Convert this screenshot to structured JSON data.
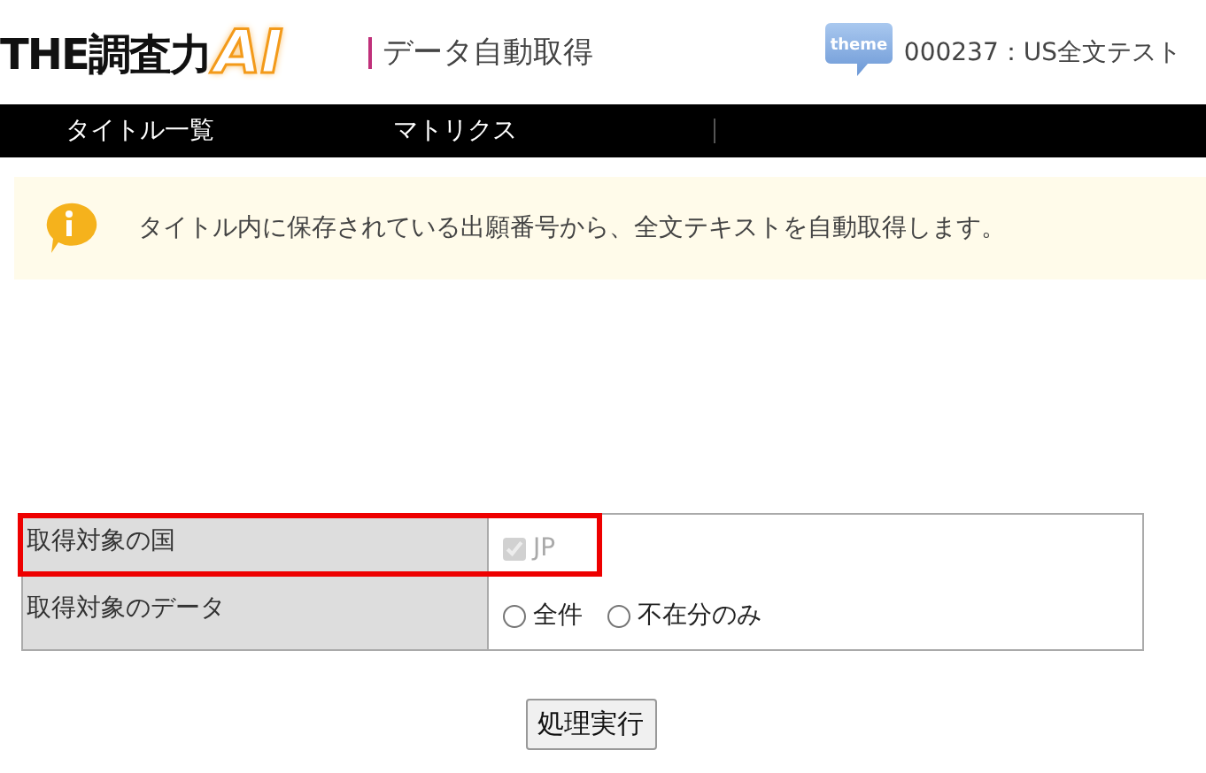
{
  "header": {
    "logo": {
      "text": "THE調査力",
      "accent": "AI"
    },
    "page_title": "データ自動取得",
    "badge": "theme",
    "project": "000237：US全文テスト"
  },
  "nav": {
    "items": [
      {
        "label": "タイトル一覧"
      },
      {
        "label": "マトリクス"
      }
    ]
  },
  "notice": {
    "text": "タイトル内に保存されている出願番号から、全文テキストを自動取得します。"
  },
  "form": {
    "rows": [
      {
        "kind": "checkbox",
        "label": "取得対象の国",
        "highlighted": true,
        "options": [
          {
            "label": "JP",
            "checked": true,
            "disabled": true
          }
        ]
      },
      {
        "kind": "radio",
        "label": "取得対象のデータ",
        "highlighted": false,
        "options": [
          {
            "label": "全件",
            "selected": false
          },
          {
            "label": "不在分のみ",
            "selected": false
          }
        ]
      }
    ]
  },
  "submit": {
    "label": "処理実行"
  }
}
